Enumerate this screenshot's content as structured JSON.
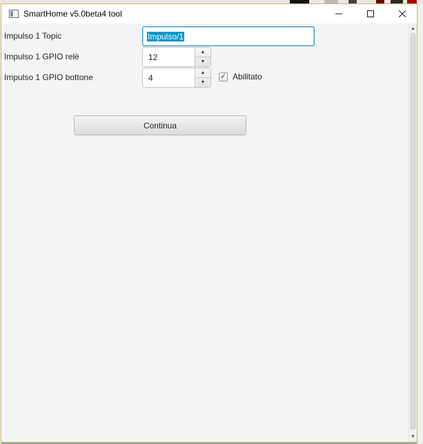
{
  "window": {
    "title": "SmartHome v5.0beta4 tool"
  },
  "form": {
    "topic_label": "Impulso 1 Topic",
    "topic_value": "Impulso/1",
    "relay_label": "Impulso 1 GPIO relè",
    "relay_value": "12",
    "button_label": "Impulso 1 GPIO bottone",
    "button_value": "4",
    "enabled_label": "Abilitato",
    "enabled_checked": true,
    "continue_label": "Continua"
  },
  "colors": {
    "selection": "#0096c9",
    "focus_border": "#3d97c4",
    "window_border": "#d9b44a"
  }
}
